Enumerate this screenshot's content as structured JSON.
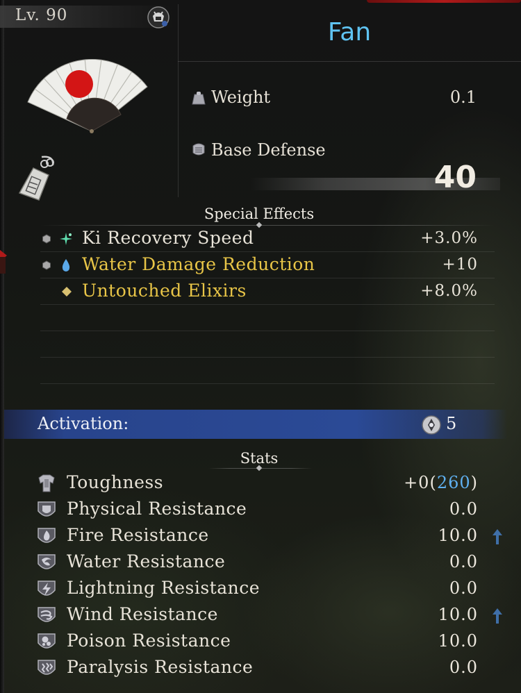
{
  "header": {
    "level": "Lv. 90",
    "item_name": "Fan",
    "title_color": "#5fc3f2"
  },
  "attributes": {
    "weight_label": "Weight",
    "weight_value": "0.1",
    "base_defense_label": "Base Defense",
    "base_defense_value": "40"
  },
  "special_effects": {
    "title": "Special Effects",
    "items": [
      {
        "label": "Ki Recovery Speed",
        "value": "+3.0%",
        "color": "#e8e3d8",
        "icon": "ki-sparkle-icon"
      },
      {
        "label": "Water Damage Reduction",
        "value": "+10",
        "color": "#e8c547",
        "icon": "water-drop-icon"
      },
      {
        "label": "Untouched Elixirs",
        "value": "+8.0%",
        "color": "#e8c547",
        "icon": "gold-diamond-icon"
      }
    ]
  },
  "activation": {
    "label": "Activation:",
    "value": "5",
    "bar_color": "#2b4a96"
  },
  "stats": {
    "title": "Stats",
    "toughness_label": "Toughness",
    "toughness_prefix": "+0(",
    "toughness_value": "260",
    "toughness_suffix": ")",
    "toughness_value_color": "#5fb0f0",
    "items": [
      {
        "label": "Physical Resistance",
        "value": "0.0",
        "icon": "physical-resistance-icon",
        "increase": false
      },
      {
        "label": "Fire Resistance",
        "value": "10.0",
        "icon": "fire-resistance-icon",
        "increase": true
      },
      {
        "label": "Water Resistance",
        "value": "0.0",
        "icon": "water-resistance-icon",
        "increase": false
      },
      {
        "label": "Lightning Resistance",
        "value": "0.0",
        "icon": "lightning-resistance-icon",
        "increase": false
      },
      {
        "label": "Wind Resistance",
        "value": "10.0",
        "icon": "wind-resistance-icon",
        "increase": true
      },
      {
        "label": "Poison Resistance",
        "value": "10.0",
        "icon": "poison-resistance-icon",
        "increase": true
      },
      {
        "label": "Paralysis Resistance",
        "value": "0.0",
        "icon": "paralysis-resistance-icon",
        "increase": false
      }
    ],
    "increase_arrow_color": "#3f6fa8"
  }
}
